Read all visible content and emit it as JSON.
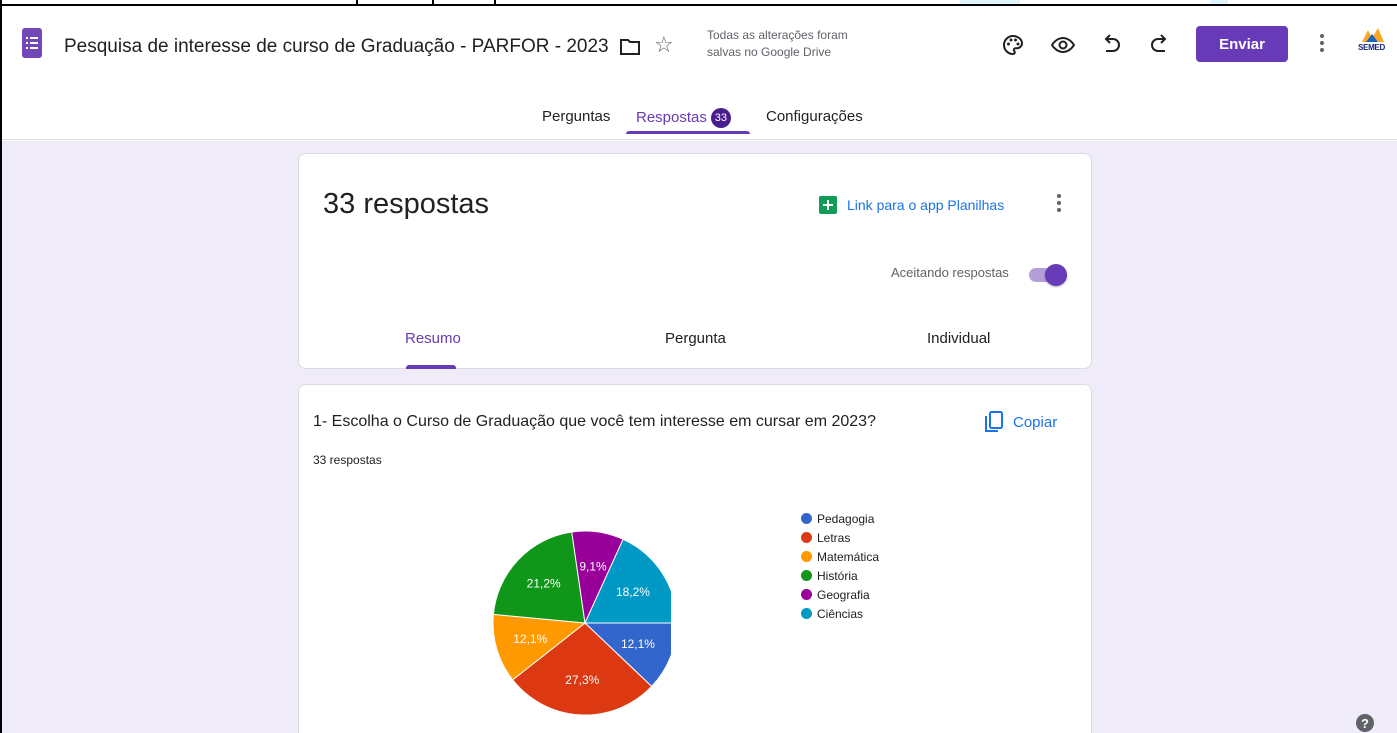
{
  "header": {
    "doc_title": "Pesquisa de interesse de curso de Graduação - PARFOR - 2023",
    "save_status_line1": "Todas as alterações foram",
    "save_status_line2": "salvas no Google Drive",
    "send_label": "Enviar",
    "account_text": "SEMED",
    "icons": [
      "forms-logo-icon",
      "folder-icon",
      "star-icon",
      "palette-icon",
      "eye-icon",
      "undo-icon",
      "redo-icon",
      "more-vert-icon"
    ]
  },
  "tabs": {
    "questions": "Perguntas",
    "responses": "Respostas",
    "responses_badge": "33",
    "settings": "Configurações"
  },
  "summary": {
    "count_title": "33 respostas",
    "sheets_link": "Link para o app Planilhas",
    "accepting_label": "Aceitando respostas",
    "accepting": true,
    "subtabs": {
      "summary": "Resumo",
      "question": "Pergunta",
      "individual": "Individual"
    }
  },
  "question": {
    "title": "1- Escolha o Curso  de Graduação que você tem interesse em cursar em 2023?",
    "count": "33 respostas",
    "copy_label": "Copiar"
  },
  "colors": {
    "accent": "#673ab7",
    "background": "#f0ebf8",
    "link": "#1a73e8"
  },
  "chart_data": {
    "type": "pie",
    "categories": [
      "Pedagogia",
      "Letras",
      "Matemática",
      "História",
      "Geografia",
      "Ciências"
    ],
    "values": [
      12.1,
      27.3,
      12.1,
      21.2,
      9.1,
      18.2
    ],
    "labels": [
      "12,1%",
      "27,3%",
      "12,1%",
      "21,2%",
      "9,1%",
      "18,2%"
    ],
    "colors": [
      "#3366cc",
      "#dc3912",
      "#ff9900",
      "#109618",
      "#990099",
      "#0099c6"
    ],
    "legend_position": "right"
  }
}
